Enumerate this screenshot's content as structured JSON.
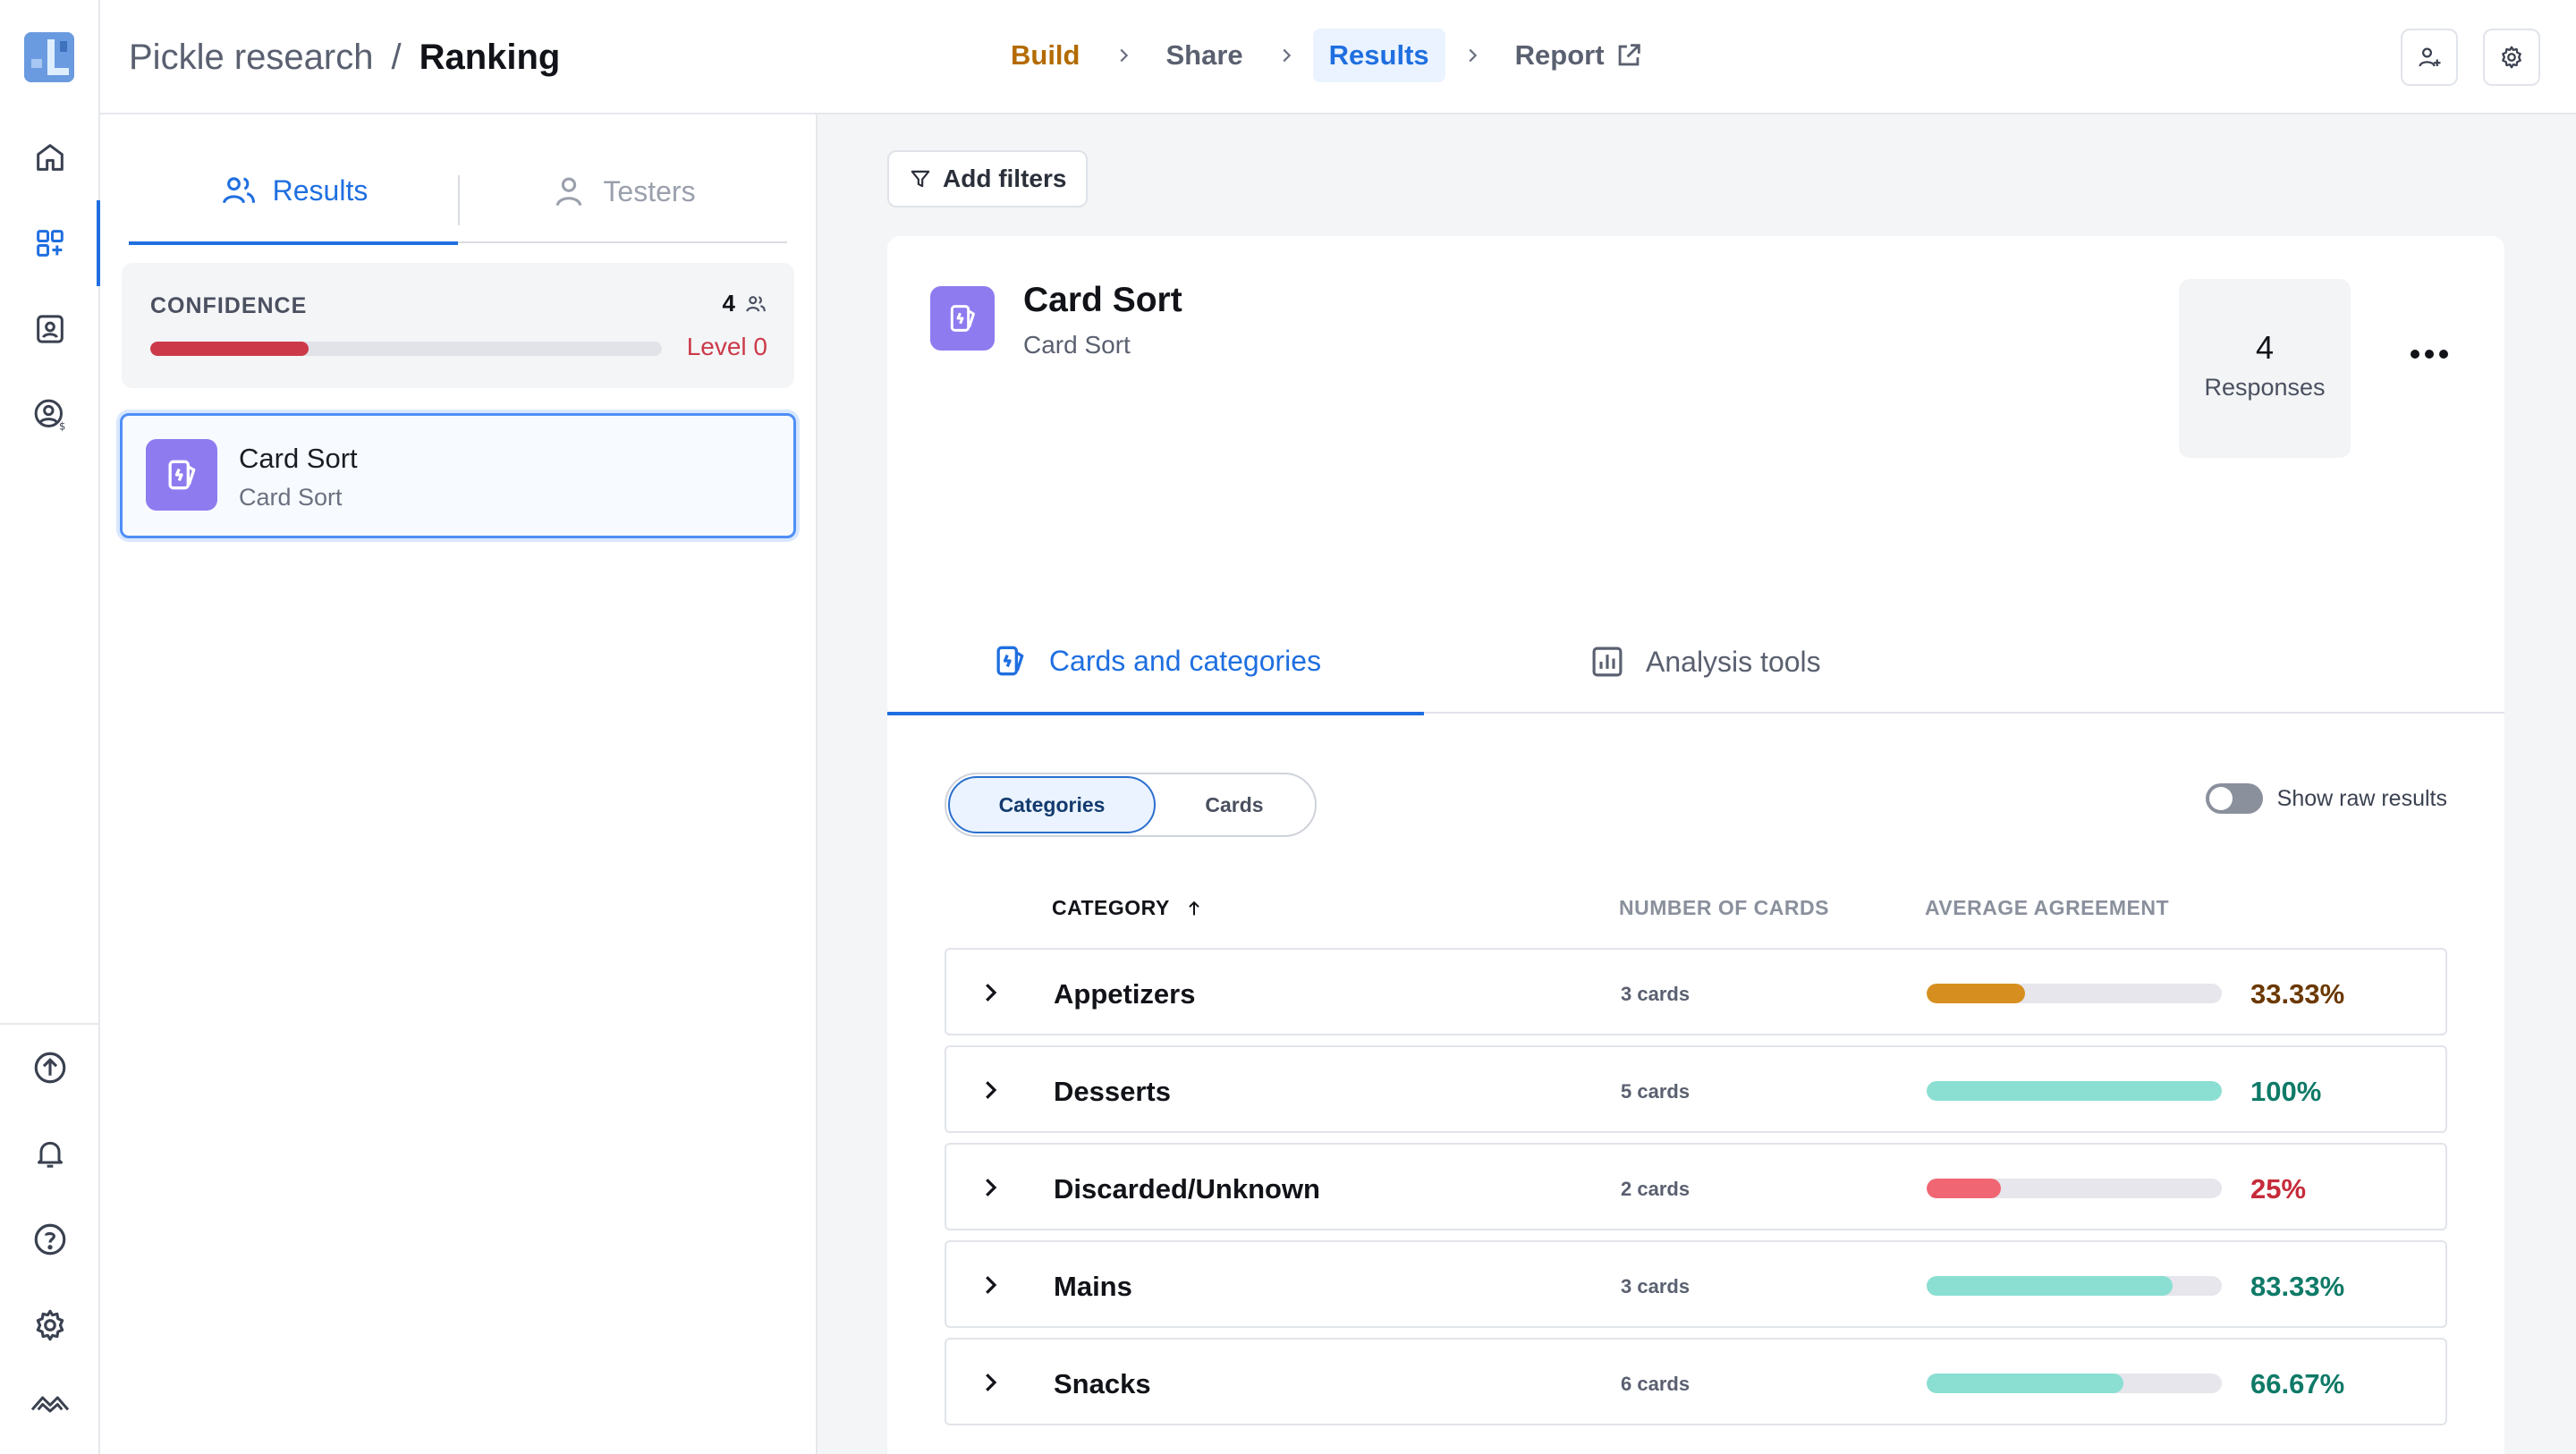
{
  "breadcrumb": {
    "parent": "Pickle research",
    "separator": "/",
    "current": "Ranking"
  },
  "steps": [
    {
      "label": "Build",
      "state": "done",
      "color": "#b36b00"
    },
    {
      "label": "Share",
      "state": "default"
    },
    {
      "label": "Results",
      "state": "active",
      "color": "#1f6fe0"
    },
    {
      "label": "Report",
      "state": "default",
      "icon": "external-link-icon"
    }
  ],
  "rail": {
    "top_items": [
      "home-icon",
      "dashboard-grid-icon",
      "contacts-icon",
      "user-billing-icon"
    ],
    "active": "dashboard-grid-icon",
    "bottom_items": [
      "upgrade-icon",
      "notifications-bell-icon",
      "help-icon",
      "settings-gear-icon",
      "brand-icon"
    ]
  },
  "top_actions": [
    "add-user-icon",
    "settings-gear-icon"
  ],
  "left_panel": {
    "tabs": [
      {
        "label": "Results",
        "icon": "users-icon",
        "active": true
      },
      {
        "label": "Testers",
        "icon": "user-icon",
        "active": false
      }
    ],
    "confidence": {
      "label": "CONFIDENCE",
      "count": "4",
      "level": "Level 0",
      "fill": 0.31,
      "color": "#cc3a4a"
    },
    "study": {
      "title": "Card Sort",
      "subtitle": "Card Sort"
    }
  },
  "main": {
    "add_filters": "Add filters",
    "card": {
      "title": "Card Sort",
      "subtitle": "Card Sort"
    },
    "responses": {
      "count": "4",
      "label": "Responses"
    },
    "tabs": [
      {
        "label": "Cards and categories",
        "icon": "card-sort-icon",
        "active": true
      },
      {
        "label": "Analysis tools",
        "icon": "bar-chart-icon",
        "active": false
      }
    ],
    "segmented": {
      "options": [
        "Categories",
        "Cards"
      ],
      "active": "Categories"
    },
    "raw_toggle": {
      "label": "Show raw results",
      "on": false
    },
    "table": {
      "headers": {
        "category": "CATEGORY",
        "number": "NUMBER OF CARDS",
        "average": "AVERAGE AGREEMENT"
      },
      "rows": [
        {
          "name": "Appetizers",
          "cards": "3 cards",
          "agreement": "33.33%",
          "value": 33.33,
          "bar_color": "#d68f1f",
          "text_color": "#6b3800"
        },
        {
          "name": "Desserts",
          "cards": "5 cards",
          "agreement": "100%",
          "value": 100,
          "bar_color": "#8adfd2",
          "text_color": "#0f7a68"
        },
        {
          "name": "Discarded/Unknown",
          "cards": "2 cards",
          "agreement": "25%",
          "value": 25,
          "bar_color": "#f06672",
          "text_color": "#c62b3a"
        },
        {
          "name": "Mains",
          "cards": "3 cards",
          "agreement": "83.33%",
          "value": 83.33,
          "bar_color": "#8adfd2",
          "text_color": "#0f7a68"
        },
        {
          "name": "Snacks",
          "cards": "6 cards",
          "agreement": "66.67%",
          "value": 66.67,
          "bar_color": "#8adfd2",
          "text_color": "#0f7a68"
        }
      ]
    }
  }
}
